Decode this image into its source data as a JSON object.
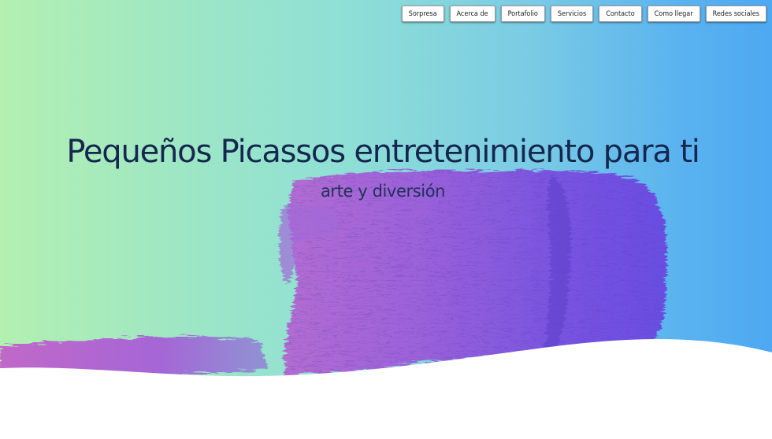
{
  "nav": {
    "items": [
      {
        "label": "Sorpresa"
      },
      {
        "label": "Acerca de"
      },
      {
        "label": "Portafolio"
      },
      {
        "label": "Servicios"
      },
      {
        "label": "Contacto"
      },
      {
        "label": "Como llegar"
      },
      {
        "label": "Redes sociales"
      }
    ]
  },
  "hero": {
    "title": "Pequeños Picassos entretenimiento para ti",
    "subtitle": "arte y diversión"
  },
  "colors": {
    "gradient_left": "#b3f0b1",
    "gradient_right": "#4ea8f2",
    "paint_stroke": "#7a4fe0",
    "title_text": "#16274f",
    "wave_fill": "#ffffff"
  }
}
